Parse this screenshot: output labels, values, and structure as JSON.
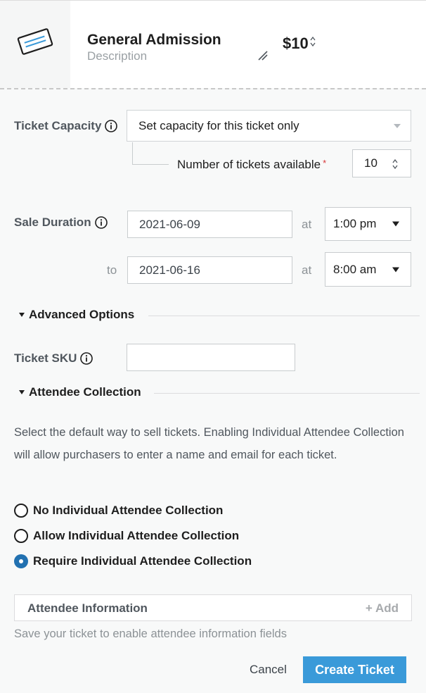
{
  "ticket": {
    "name": "General Admission",
    "description_placeholder": "Description",
    "price": "$10"
  },
  "capacity": {
    "label": "Ticket Capacity",
    "select_value": "Set capacity for this ticket only",
    "available_label": "Number of tickets available",
    "required_mark": "*",
    "available_value": "10"
  },
  "sale_duration": {
    "label": "Sale Duration",
    "start_date": "2021-06-09",
    "at_label": "at",
    "start_time": "1:00 pm",
    "to_label": "to",
    "end_date": "2021-06-16",
    "end_time": "8:00 am"
  },
  "advanced": {
    "title": "Advanced Options",
    "sku_label": "Ticket SKU",
    "sku_value": ""
  },
  "attendee": {
    "title": "Attendee Collection",
    "description": "Select the default way to sell tickets. Enabling Individual Attendee Collection will allow purchasers to enter a name and email for each ticket.",
    "options": [
      {
        "label": "No Individual Attendee Collection",
        "selected": false
      },
      {
        "label": "Allow Individual Attendee Collection",
        "selected": false
      },
      {
        "label": "Require Individual Attendee Collection",
        "selected": true
      }
    ],
    "info_title": "Attendee Information",
    "add_label": "+ Add",
    "hint": "Save your ticket to enable attendee information fields"
  },
  "actions": {
    "cancel": "Cancel",
    "create": "Create Ticket"
  },
  "colors": {
    "primary_button": "#3a9ad9",
    "radio_selected": "#2271b1",
    "required": "#d63638"
  }
}
